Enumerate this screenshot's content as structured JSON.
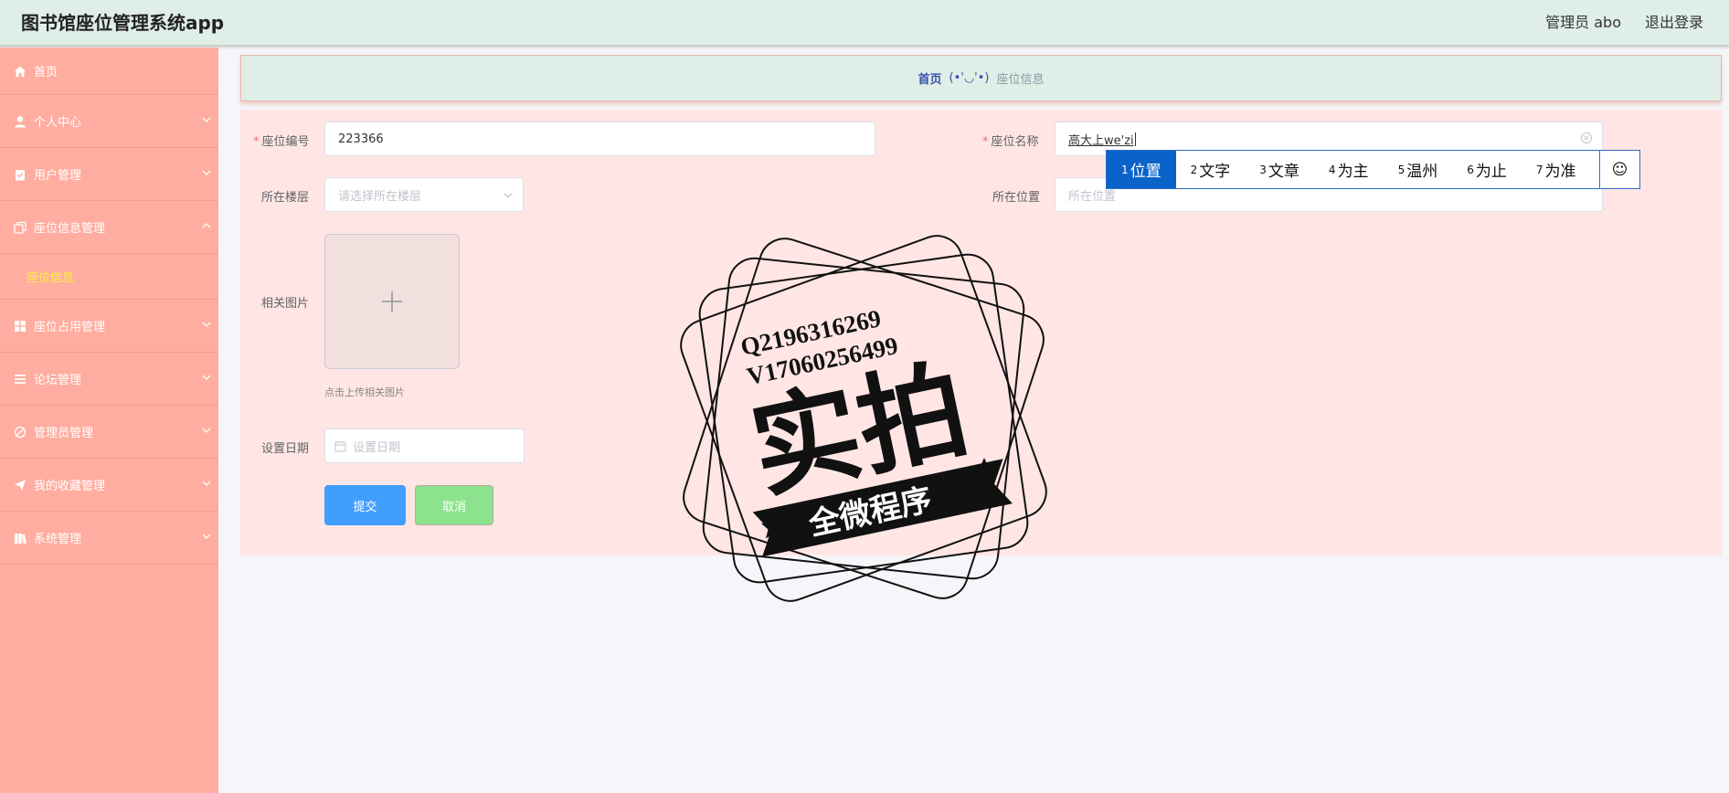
{
  "header": {
    "app_title": "图书馆座位管理系统app",
    "admin_label": "管理员 abo",
    "logout_label": "退出登录"
  },
  "sidebar": {
    "items": [
      {
        "label": "首页",
        "icon": "home-icon"
      },
      {
        "label": "个人中心",
        "icon": "user-icon"
      },
      {
        "label": "用户管理",
        "icon": "clipboard-icon"
      },
      {
        "label": "座位信息管理",
        "icon": "copy-icon",
        "expanded": true
      },
      {
        "label": "座位占用管理",
        "icon": "grid-icon"
      },
      {
        "label": "论坛管理",
        "icon": "list-icon"
      },
      {
        "label": "管理员管理",
        "icon": "edit-off-icon"
      },
      {
        "label": "我的收藏管理",
        "icon": "send-icon"
      },
      {
        "label": "系统管理",
        "icon": "book-icon"
      }
    ],
    "subitem_label": "座位信息"
  },
  "breadcrumb": {
    "home": "首页",
    "separator": "(•'◡'•)",
    "current": "座位信息"
  },
  "form": {
    "seat_no_label": "座位编号",
    "seat_no_value": "223366",
    "seat_name_label": "座位名称",
    "seat_name_value": "高大上we'zi",
    "floor_label": "所在楼层",
    "floor_placeholder": "请选择所在楼层",
    "location_label": "所在位置",
    "location_placeholder": "所在位置",
    "image_label": "相关图片",
    "upload_hint": "点击上传相关图片",
    "date_label": "设置日期",
    "date_placeholder": "设置日期",
    "submit_label": "提交",
    "cancel_label": "取消"
  },
  "ime": {
    "candidates": [
      {
        "num": "1",
        "text": "位置"
      },
      {
        "num": "2",
        "text": "文字"
      },
      {
        "num": "3",
        "text": "文章"
      },
      {
        "num": "4",
        "text": "为主"
      },
      {
        "num": "5",
        "text": "温州"
      },
      {
        "num": "6",
        "text": "为止"
      },
      {
        "num": "7",
        "text": "为准"
      }
    ],
    "emoji_glyph": "☺"
  },
  "watermark": {
    "line1": "Q2196316269",
    "line2": "V17060256499",
    "big": "实拍",
    "ribbon": "全微程序"
  },
  "colors": {
    "header_bg": "#dfeee6",
    "sidebar_bg": "#ffada0",
    "panel_bg": "#ffe6e4",
    "submit_bg": "#409eff",
    "cancel_bg": "#8de38d",
    "submenu_text": "#f7f33a",
    "ime_active": "#0a63c9"
  }
}
